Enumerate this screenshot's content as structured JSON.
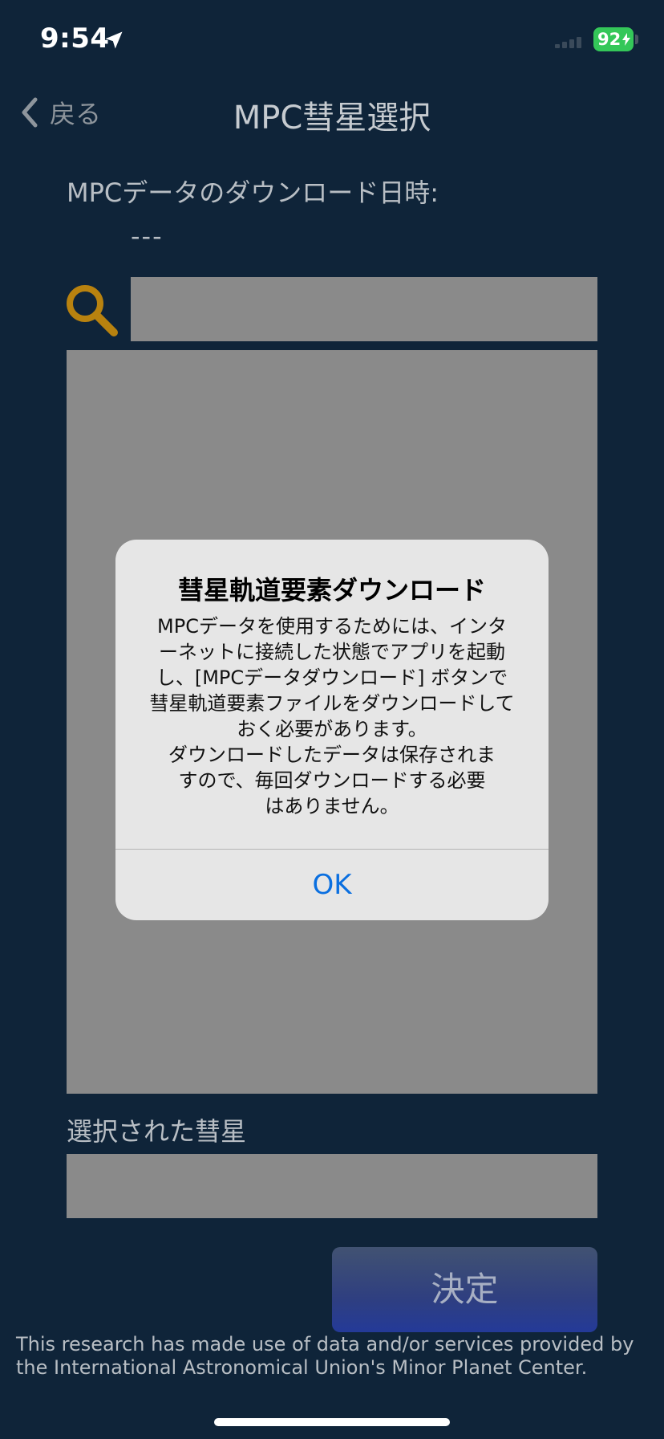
{
  "status_bar": {
    "time": "9:54",
    "battery": "92",
    "location_icon": "location-arrow-icon",
    "signal_icon": "cellular-signal-icon"
  },
  "nav": {
    "back_label": "戻る",
    "title": "MPC彗星選択"
  },
  "main": {
    "download_label": "MPCデータのダウンロード日時:",
    "download_value": "---",
    "search_icon": "magnifier-icon",
    "search_value": "",
    "selected_label": "選択された彗星",
    "selected_value": "",
    "decide_label": "決定",
    "credit": "This research has made use of data and/or services provided by the International Astronomical Union's Minor Planet Center."
  },
  "alert": {
    "title": "彗星軌道要素ダウンロード",
    "message_lines": [
      "MPCデータを使用するためには、インタ",
      "ーネットに接続した状態でアプリを起動",
      "し、[MPCデータダウンロード] ボタンで",
      "彗星軌道要素ファイルをダウンロードして",
      "おく必要があります。",
      "ダウンロードしたデータは保存されま",
      "すので、毎回ダウンロードする必要",
      "はありません。"
    ],
    "ok_label": "OK"
  },
  "colors": {
    "background": "#0f2439",
    "panel_gray": "#8a8a8a",
    "accent_gold": "#b8820f",
    "battery_green": "#34c759",
    "button_blue": "#2f3f80",
    "alert_link": "#0a6fe0"
  }
}
